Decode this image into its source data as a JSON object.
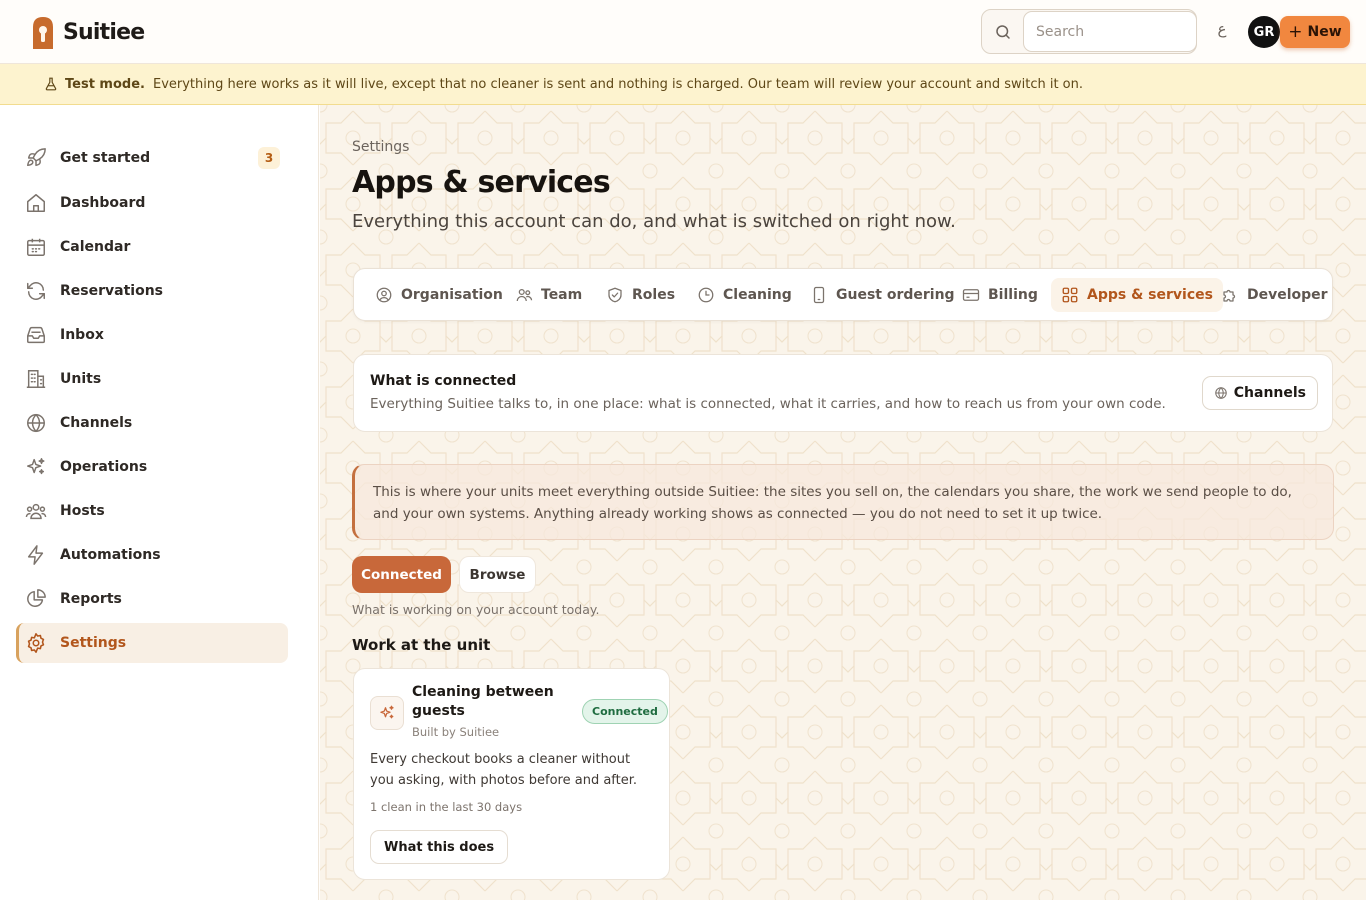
{
  "app": {
    "name": "Suitiee"
  },
  "header": {
    "search_placeholder": "Search",
    "lang_glyph": "ع",
    "avatar_initials": "GR",
    "new_label": "New"
  },
  "banner": {
    "strong": "Test mode.",
    "text": "Everything here works as it will live, except that no cleaner is sent and nothing is charged. Our team will review your account and switch it on."
  },
  "sidebar": {
    "items": [
      {
        "label": "Get started",
        "icon": "rocket-icon",
        "badge": "3"
      },
      {
        "label": "Dashboard",
        "icon": "home-icon"
      },
      {
        "label": "Calendar",
        "icon": "calendar-icon"
      },
      {
        "label": "Reservations",
        "icon": "sync-icon"
      },
      {
        "label": "Inbox",
        "icon": "inbox-icon"
      },
      {
        "label": "Units",
        "icon": "building-icon"
      },
      {
        "label": "Channels",
        "icon": "globe-icon"
      },
      {
        "label": "Operations",
        "icon": "sparkles-icon"
      },
      {
        "label": "Hosts",
        "icon": "users-icon"
      },
      {
        "label": "Automations",
        "icon": "bolt-icon"
      },
      {
        "label": "Reports",
        "icon": "pie-chart-icon"
      },
      {
        "label": "Settings",
        "icon": "gear-icon",
        "active": true
      }
    ]
  },
  "page": {
    "breadcrumb": "Settings",
    "title": "Apps & services",
    "subtitle": "Everything this account can do, and what is switched on right now."
  },
  "tabs": [
    {
      "label": "Organisation",
      "icon": "user-circle-icon"
    },
    {
      "label": "Team",
      "icon": "team-icon"
    },
    {
      "label": "Roles",
      "icon": "shield-check-icon"
    },
    {
      "label": "Cleaning",
      "icon": "clock-icon"
    },
    {
      "label": "Guest ordering",
      "icon": "phone-icon"
    },
    {
      "label": "Billing",
      "icon": "credit-card-icon"
    },
    {
      "label": "Apps & services",
      "icon": "grid-icon",
      "active": true
    },
    {
      "label": "Developer",
      "icon": "puzzle-icon"
    }
  ],
  "connected": {
    "title": "What is connected",
    "desc": "Everything Suitiee talks to, in one place: what is connected, what it carries, and how to reach us from your own code.",
    "channels_label": "Channels"
  },
  "note": "This is where your units meet everything outside Suitiee: the sites you sell on, the calendars you share, the work we send people to do, and your own systems. Anything already working shows as connected — you do not need to set it up twice.",
  "filter": {
    "connected_label": "Connected",
    "browse_label": "Browse",
    "hint": "What is working on your account today."
  },
  "section": {
    "title": "Work at the unit"
  },
  "service": {
    "name": "Cleaning between guests",
    "by": "Built by Suitiee",
    "status": "Connected",
    "desc": "Every checkout books a cleaner without you asking, with photos before and after.",
    "meta": "1 clean in the last 30 days",
    "button": "What this does"
  },
  "colors": {
    "accent": "#c8683a",
    "brand": "#c76b2d",
    "new_button": "#f1873f",
    "banner_bg": "#fdf3cf",
    "active_nav_text": "#b2561c",
    "success": "#1f6c40"
  }
}
